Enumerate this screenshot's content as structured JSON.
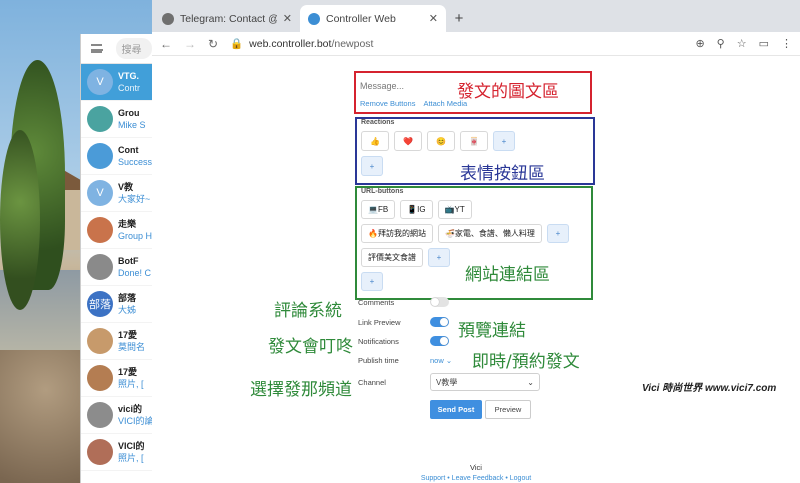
{
  "telegram": {
    "search_placeholder": "搜尋",
    "chats": [
      {
        "name": "VTG.",
        "sub": "Contr",
        "avatar": "V",
        "color": "#7fb3e2",
        "active": true
      },
      {
        "name": "Grou",
        "sub": "Mike S",
        "avatar": "",
        "color": "#4aa3a0",
        "active": false
      },
      {
        "name": "Cont",
        "sub": "Success",
        "avatar": "",
        "color": "#4b9bd8",
        "active": false
      },
      {
        "name": "V教",
        "sub": "大家好~",
        "avatar": "V",
        "color": "#7fb3e2",
        "active": false
      },
      {
        "name": "走樂",
        "sub": "Group H",
        "avatar": "",
        "color": "#c9734b",
        "active": false
      },
      {
        "name": "BotF",
        "sub": "Done! C",
        "avatar": "",
        "color": "#8a8a8a",
        "active": false
      },
      {
        "name": "部落",
        "sub": "大姊",
        "avatar": "部落",
        "color": "#3c72c4",
        "active": false
      },
      {
        "name": "17愛",
        "sub": "莫問名",
        "avatar": "",
        "color": "#c79a6b",
        "active": false
      },
      {
        "name": "17愛",
        "sub": "照片, [",
        "avatar": "",
        "color": "#b47d52",
        "active": false
      },
      {
        "name": "vici的",
        "sub": "VICI的論",
        "avatar": "",
        "color": "#8c8c8c",
        "active": false
      },
      {
        "name": "VICI的",
        "sub": "照片, [",
        "avatar": "",
        "color": "#b06e58",
        "active": false
      }
    ]
  },
  "browser": {
    "tabs": [
      {
        "label": "Telegram: Contact @imagebot",
        "active": false
      },
      {
        "label": "Controller Web",
        "active": true
      }
    ],
    "url_host": "web.controller.bot",
    "url_path": "/newpost"
  },
  "post": {
    "message_placeholder": "Message...",
    "remove_buttons": "Remove Buttons",
    "attach_media": "Attach Media",
    "reactions_title": "Reactions",
    "reactions": [
      "👍",
      "❤️",
      "😊",
      "🀄"
    ],
    "add": "+",
    "url_title": "URL-buttons",
    "url_row1": [
      "💻FB",
      "📱IG",
      "📺YT"
    ],
    "url_row2": [
      "🔥拜訪我的網站",
      "🍜家電、食譜、懶人料理"
    ],
    "url_row3": [
      "評價美文食譜"
    ],
    "comments_label": "Comments",
    "link_preview_label": "Link Preview",
    "notifications_label": "Notifications",
    "publish_time_label": "Publish time",
    "publish_time_value": "now ⌄",
    "channel_label": "Channel",
    "channel_value": "V教學",
    "send_post": "Send Post",
    "preview": "Preview",
    "footer_user": "Vici",
    "footer_links": "Support • Leave Feedback • Logout"
  },
  "annotations": {
    "message_area": "發文的圖文區",
    "reactions_area": "表情按鈕區",
    "url_area": "網站連結區",
    "comments": "評論系統",
    "link_preview": "預覽連結",
    "notifications": "發文會叮咚",
    "publish": "即時/預約發文",
    "channel": "選擇發那頻道"
  },
  "watermark": "Vici 時尚世界 www.vici7.com",
  "colors": {
    "message_border": "#d5232f",
    "reactions_border": "#2a3797",
    "url_border": "#2f8a3a",
    "accent": "#3f8fe0"
  }
}
